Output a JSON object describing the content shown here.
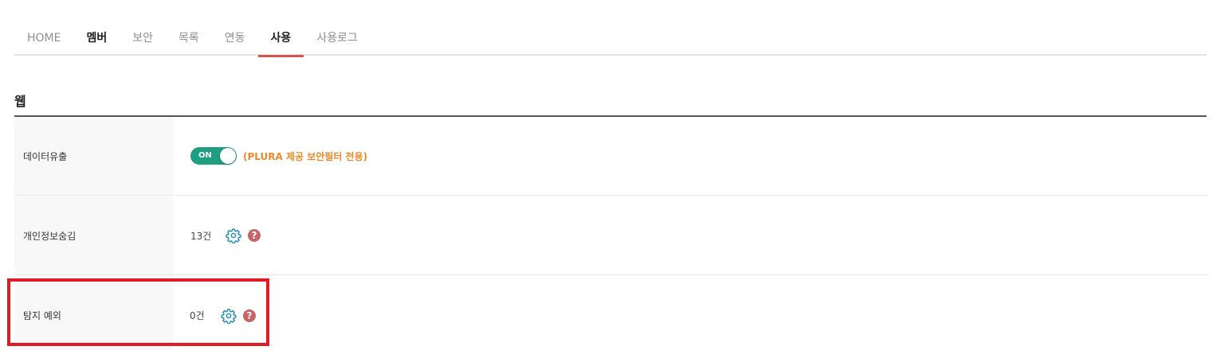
{
  "tabs": [
    {
      "label": "HOME"
    },
    {
      "label": "멤버"
    },
    {
      "label": "보안"
    },
    {
      "label": "목록"
    },
    {
      "label": "연동"
    },
    {
      "label": "사용"
    },
    {
      "label": "사용로그"
    }
  ],
  "section": {
    "title": "웹"
  },
  "rows": [
    {
      "label": "데이터유출",
      "toggle_label": "ON",
      "note": "(PLURA 제공 보안필터 전용)"
    },
    {
      "label": "개인정보숨김",
      "count": "13건"
    },
    {
      "label": "탐지 예외",
      "count": "0건"
    }
  ],
  "help_glyph": "?",
  "colors": {
    "toggle_on": "#1e9e82",
    "note": "#ec8a2a",
    "active_tab_underline": "#d9534f",
    "gear": "#2a8fb0",
    "help": "#c96466",
    "highlight_box": "#e01b24"
  }
}
